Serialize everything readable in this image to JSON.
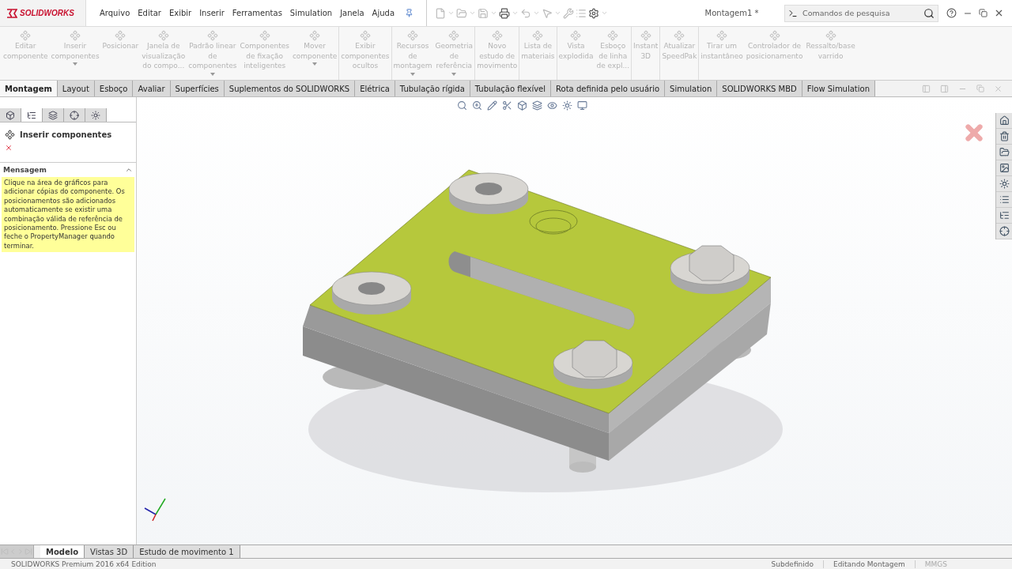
{
  "app": {
    "logo": "SOLIDWORKS"
  },
  "menu": [
    "Arquivo",
    "Editar",
    "Exibir",
    "Inserir",
    "Ferramentas",
    "Simulation",
    "Janela",
    "Ajuda"
  ],
  "document_title": "Montagem1 *",
  "search": {
    "placeholder": "Comandos de pesquisa"
  },
  "ribbon": [
    {
      "lines": [
        "Editar",
        "componente"
      ],
      "dropdown": false,
      "disabled": true,
      "group_start": false
    },
    {
      "lines": [
        "Inserir",
        "componentes"
      ],
      "dropdown": true,
      "disabled": true,
      "group_start": false
    },
    {
      "lines": [
        "Posicionar"
      ],
      "dropdown": false,
      "disabled": true,
      "group_start": false
    },
    {
      "lines": [
        "Janela de",
        "visualização",
        "do compo..."
      ],
      "dropdown": false,
      "disabled": true,
      "group_start": false
    },
    {
      "lines": [
        "Padrão linear",
        "de",
        "componentes"
      ],
      "dropdown": true,
      "disabled": true,
      "group_start": false
    },
    {
      "lines": [
        "Componentes",
        "de fixação",
        "inteligentes"
      ],
      "dropdown": false,
      "disabled": true,
      "group_start": false
    },
    {
      "lines": [
        "Mover",
        "componente"
      ],
      "dropdown": true,
      "disabled": true,
      "group_start": false
    },
    {
      "lines": [
        "Exibir",
        "componentes",
        "ocultos"
      ],
      "dropdown": false,
      "disabled": true,
      "group_start": true
    },
    {
      "lines": [
        "Recursos",
        "de",
        "montagem"
      ],
      "dropdown": true,
      "disabled": true,
      "group_start": true
    },
    {
      "lines": [
        "Geometria",
        "de",
        "referência"
      ],
      "dropdown": true,
      "disabled": true,
      "group_start": false
    },
    {
      "lines": [
        "Novo",
        "estudo de",
        "movimento"
      ],
      "dropdown": false,
      "disabled": true,
      "group_start": true
    },
    {
      "lines": [
        "Lista de",
        "materiais"
      ],
      "dropdown": false,
      "disabled": true,
      "group_start": true
    },
    {
      "lines": [
        "Vista",
        "explodida"
      ],
      "dropdown": false,
      "disabled": true,
      "group_start": true
    },
    {
      "lines": [
        "Esboço",
        "de linha",
        "de expl..."
      ],
      "dropdown": false,
      "disabled": true,
      "group_start": false
    },
    {
      "lines": [
        "Instant",
        "3D"
      ],
      "dropdown": false,
      "disabled": true,
      "group_start": true
    },
    {
      "lines": [
        "Atualizar",
        "SpeedPak"
      ],
      "dropdown": false,
      "disabled": true,
      "group_start": true
    },
    {
      "lines": [
        "Tirar um",
        "instantâneo"
      ],
      "dropdown": false,
      "disabled": true,
      "group_start": true
    },
    {
      "lines": [
        "Controlador de",
        "posicionamento"
      ],
      "dropdown": false,
      "disabled": true,
      "group_start": false
    },
    {
      "lines": [
        "Ressalto/base",
        "varrido"
      ],
      "dropdown": false,
      "disabled": true,
      "group_start": false
    }
  ],
  "tabs": [
    {
      "label": "Montagem",
      "selected": true
    },
    {
      "label": "Layout",
      "selected": false
    },
    {
      "label": "Esboço",
      "selected": false
    },
    {
      "label": "Avaliar",
      "selected": false
    },
    {
      "label": "Superfícies",
      "selected": false
    },
    {
      "label": "Suplementos do SOLIDWORKS",
      "selected": false
    },
    {
      "label": "Elétrica",
      "selected": false
    },
    {
      "label": "Tubulação rígida",
      "selected": false
    },
    {
      "label": "Tubulação flexível",
      "selected": false
    },
    {
      "label": "Rota definida pelo usuário",
      "selected": false
    },
    {
      "label": "Simulation",
      "selected": false
    },
    {
      "label": "SOLIDWORKS MBD",
      "selected": false
    },
    {
      "label": "Flow Simulation",
      "selected": false
    }
  ],
  "panel_tabs": [
    {
      "selected": false
    },
    {
      "selected": true
    },
    {
      "selected": false
    },
    {
      "selected": false
    },
    {
      "selected": false
    }
  ],
  "property_manager": {
    "title": "Inserir componentes",
    "section": "Mensagem",
    "message": "Clique na área de gráficos para adicionar cópias do componente. Os posicionamentos são adicionados automaticamente se existir uma combinação válida de referência de posicionamento. Pressione Esc ou feche o PropertyManager quando terminar."
  },
  "bottom_tabs": [
    {
      "label": "Modelo",
      "selected": true
    },
    {
      "label": "Vistas 3D",
      "selected": false
    },
    {
      "label": "Estudo de movimento 1",
      "selected": false
    }
  ],
  "status_bar": {
    "edition": "SOLIDWORKS Premium 2016 x64 Edition",
    "state": "Subdefinido",
    "mode": "Editando Montagem",
    "units": "MMGS"
  }
}
